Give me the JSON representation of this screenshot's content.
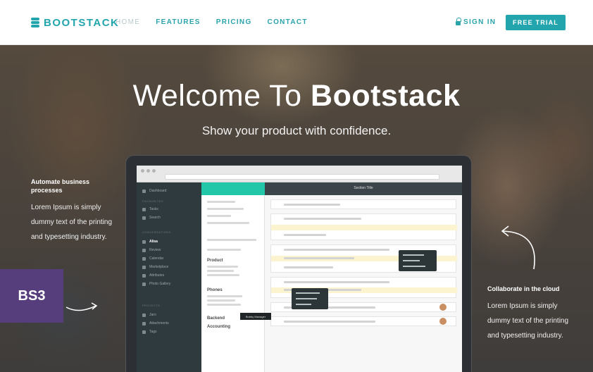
{
  "nav": {
    "brand": "BOOTSTACK",
    "links": [
      "HOME",
      "FEATURES",
      "PRICING",
      "CONTACT"
    ],
    "signin": "SIGN IN",
    "cta": "FREE TRIAL"
  },
  "hero": {
    "title_light": "Welcome To ",
    "title_bold": "Bootstack",
    "subtitle": "Show your product with confidence.",
    "feature_left": {
      "heading": "Automate business processes",
      "body": "Lorem Ipsum is simply dummy text of the printing and typesetting industry."
    },
    "feature_right": {
      "heading": "Collaborate in the cloud",
      "body": "Lorem Ipsum is simply dummy text of the printing and typesetting industry."
    }
  },
  "badge": "BS3",
  "colors": {
    "accent": "#22a5ad",
    "badge_bg": "#563d7c",
    "app_sidebar": "#2f3a3f",
    "app_mid_header": "#22c7a9"
  },
  "icons": [
    "logo-stack-icon",
    "lock-icon",
    "curved-arrow-icon"
  ],
  "mockup": {
    "sidebar_items": [
      "Dashboard",
      "Tasks",
      "Search",
      "Alisa",
      "Review",
      "Calendar",
      "Marketplace",
      "Attributes",
      "Photo Gallery",
      "Jaro",
      "Attachments",
      "Tags"
    ],
    "mid_labels": [
      "Product",
      "Phones",
      "Backend",
      "Accounting"
    ],
    "main_title": "Section Title",
    "tooltip": "Bobby Manager"
  }
}
